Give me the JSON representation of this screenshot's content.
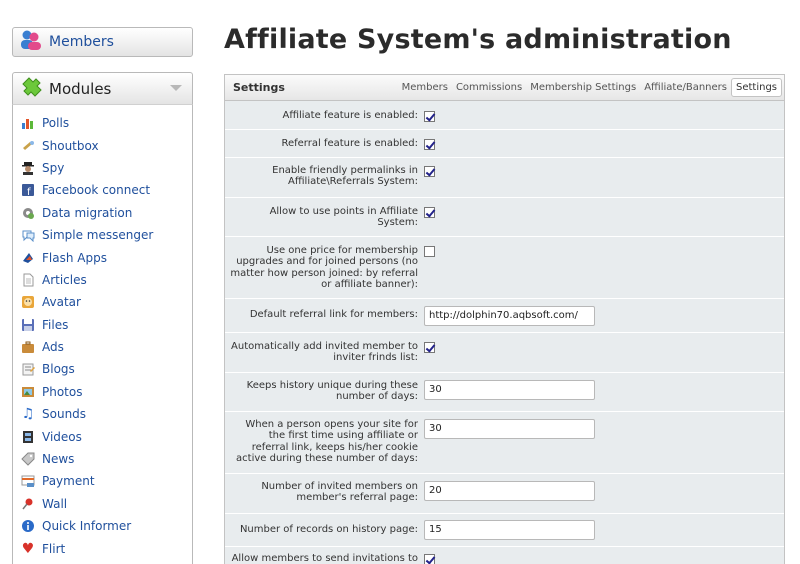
{
  "sidebar": {
    "members_label": "Members",
    "modules_label": "Modules",
    "modules": [
      {
        "label": "Polls",
        "icon": "bar-chart-icon"
      },
      {
        "label": "Shoutbox",
        "icon": "shout-icon"
      },
      {
        "label": "Spy",
        "icon": "spy-icon"
      },
      {
        "label": "Facebook connect",
        "icon": "facebook-icon"
      },
      {
        "label": "Data migration",
        "icon": "gear-icon"
      },
      {
        "label": "Simple messenger",
        "icon": "chat-icon"
      },
      {
        "label": "Flash Apps",
        "icon": "flash-icon"
      },
      {
        "label": "Articles",
        "icon": "document-icon"
      },
      {
        "label": "Avatar",
        "icon": "avatar-icon"
      },
      {
        "label": "Files",
        "icon": "floppy-icon"
      },
      {
        "label": "Ads",
        "icon": "briefcase-icon"
      },
      {
        "label": "Blogs",
        "icon": "blog-icon"
      },
      {
        "label": "Photos",
        "icon": "photo-icon"
      },
      {
        "label": "Sounds",
        "icon": "music-note-icon"
      },
      {
        "label": "Videos",
        "icon": "film-icon"
      },
      {
        "label": "News",
        "icon": "tag-icon"
      },
      {
        "label": "Payment",
        "icon": "payment-icon"
      },
      {
        "label": "Wall",
        "icon": "pin-icon"
      },
      {
        "label": "Quick Informer",
        "icon": "info-icon"
      },
      {
        "label": "Flirt",
        "icon": "heart-icon"
      }
    ]
  },
  "page_title": "Affiliate System's administration",
  "panel": {
    "title": "Settings",
    "tabs": [
      "Members",
      "Commissions",
      "Membership Settings",
      "Affiliate/Banners",
      "Settings"
    ],
    "active_tab": "Settings"
  },
  "settings": [
    {
      "label": "Affiliate feature is enabled:",
      "type": "checkbox",
      "checked": true
    },
    {
      "label": "Referral feature is enabled:",
      "type": "checkbox",
      "checked": true
    },
    {
      "label": "Enable friendly permalinks in Affiliate\\Referrals System:",
      "type": "checkbox",
      "checked": true
    },
    {
      "label": "Allow to use points in Affiliate System:",
      "type": "checkbox",
      "checked": true
    },
    {
      "label": "Use one price for membership upgrades and for joined persons (no matter how person joined: by referral or affiliate banner):",
      "type": "checkbox",
      "checked": false
    },
    {
      "label": "Default referral link for members:",
      "type": "text",
      "value": "http://dolphin70.aqbsoft.com/"
    },
    {
      "label": "Automatically add invited member to inviter frinds list:",
      "type": "checkbox",
      "checked": true
    },
    {
      "label": "Keeps history unique during these number of days:",
      "type": "text",
      "value": "30"
    },
    {
      "label": "When a person opens your site for the first time using affiliate or referral link, keeps his/her cookie active during these number of days:",
      "type": "text",
      "value": "30"
    },
    {
      "label": "Number of invited members on member's referral page:",
      "type": "text",
      "value": "20"
    },
    {
      "label": "Number of records on history page:",
      "type": "text",
      "value": "15"
    },
    {
      "label": "Allow members to send invitations to",
      "type": "checkbox",
      "checked": true
    }
  ]
}
